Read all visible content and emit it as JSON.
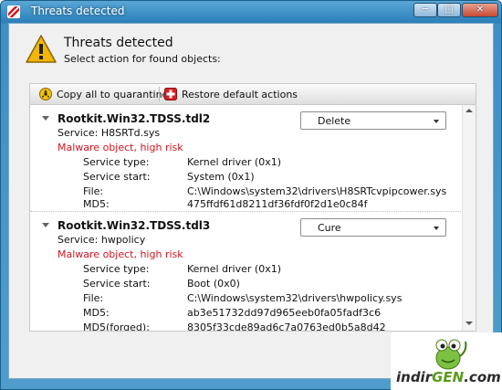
{
  "window": {
    "title": "Threats detected"
  },
  "titlebar_buttons": {
    "minimize": "─",
    "maximize": "□",
    "close": "✕"
  },
  "header": {
    "title": "Threats detected",
    "subtitle": "Select action for found objects:"
  },
  "toolbar": {
    "copy_label": "Copy all to quarantine",
    "restore_label": "Restore default actions"
  },
  "labels": {
    "service_type": "Service type:",
    "service_start": "Service start:",
    "file": "File:",
    "md5": "MD5:",
    "md5_forged": "MD5(forged):"
  },
  "threats": [
    {
      "name": "Rootkit.Win32.TDSS.tdl2",
      "service": "Service: H8SRTd.sys",
      "risk": "Malware object, high risk",
      "action": "Delete",
      "service_type": "Kernel driver (0x1)",
      "service_start": "System (0x1)",
      "file": "C:\\Windows\\system32\\drivers\\H8SRTcvpipcower.sys",
      "md5": "475ffdf61d8211df36fdf0f2d1e0c84f"
    },
    {
      "name": "Rootkit.Win32.TDSS.tdl3",
      "service": "Service: hwpolicy",
      "risk": "Malware object, high risk",
      "action": "Cure",
      "service_type": "Kernel driver (0x1)",
      "service_start": "Boot (0x0)",
      "file": "C:\\Windows\\system32\\drivers\\hwpolicy.sys",
      "md5": "ab3e51732dd97d965eeb0fa05fadf3c6",
      "md5_forged": "8305f33cde89ad6c7a0763ed0b5a8d42"
    }
  ],
  "brand": {
    "part1": "indir",
    "part2": "GEN",
    "part3": ".com"
  },
  "colors": {
    "risk": "#d0161e",
    "title_bar": "#2a7fb8"
  }
}
